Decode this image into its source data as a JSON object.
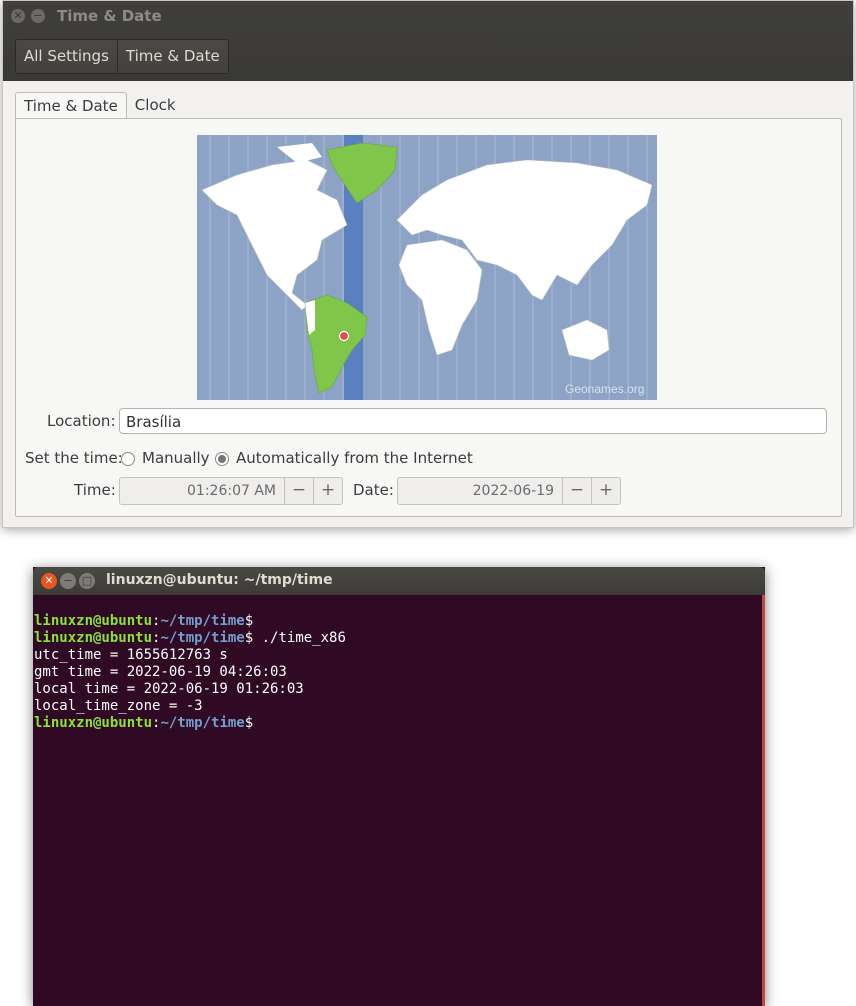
{
  "settings_window": {
    "title": "Time & Date",
    "breadcrumbs": [
      "All Settings",
      "Time & Date"
    ],
    "tabs": [
      "Time & Date",
      "Clock"
    ],
    "map": {
      "credit": "Geonames.org"
    },
    "location": {
      "label": "Location:",
      "value": "Brasília"
    },
    "set_time": {
      "label": "Set the time:",
      "options": [
        "Manually",
        "Automatically from the Internet"
      ],
      "selected": "Automatically from the Internet"
    },
    "time": {
      "label": "Time:",
      "value": "01:26:07 AM"
    },
    "date": {
      "label": "Date:",
      "value": "2022-06-19"
    },
    "spin": {
      "minus": "−",
      "plus": "+"
    }
  },
  "terminal": {
    "title": "linuxzn@ubuntu: ~/tmp/time",
    "prompt_user": "linuxzn@ubuntu",
    "prompt_path": "~/tmp/time",
    "lines": [
      {
        "type": "prompt",
        "cmd": ""
      },
      {
        "type": "prompt",
        "cmd": " ./time_x86"
      },
      {
        "type": "out",
        "text": "utc_time = 1655612763 s"
      },
      {
        "type": "out",
        "text": "gmt time = 2022-06-19 04:26:03"
      },
      {
        "type": "out",
        "text": "local time = 2022-06-19 01:26:03"
      },
      {
        "type": "out",
        "text": "local_time_zone = -3"
      },
      {
        "type": "prompt",
        "cmd": ""
      }
    ]
  },
  "colors": {
    "terminal_bg": "#300a24",
    "prompt_user": "#8ae234",
    "prompt_path": "#729fcf",
    "highlight_zone": "#7fc64a",
    "map_water": "#8da3c6"
  }
}
